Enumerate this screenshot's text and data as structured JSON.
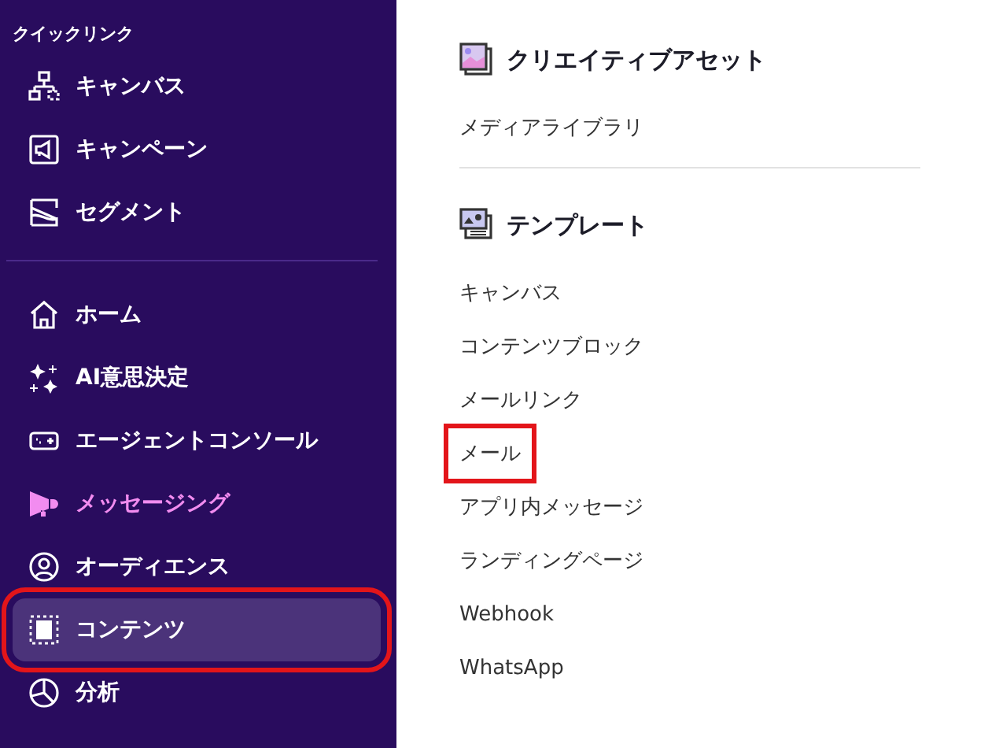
{
  "sidebar": {
    "quick_links_title": "クイックリンク",
    "quick_links": [
      {
        "label": "キャンバス",
        "kind": "canvas"
      },
      {
        "label": "キャンペーン",
        "kind": "campaign"
      },
      {
        "label": "セグメント",
        "kind": "segment"
      }
    ],
    "items": [
      {
        "label": "ホーム",
        "kind": "home",
        "selected": false,
        "active": false,
        "highlighted": false
      },
      {
        "label": "AI意思決定",
        "kind": "ai",
        "selected": false,
        "active": false,
        "highlighted": false
      },
      {
        "label": "エージェントコンソール",
        "kind": "agent",
        "selected": false,
        "active": false,
        "highlighted": false
      },
      {
        "label": "メッセージング",
        "kind": "messaging",
        "selected": false,
        "active": true,
        "highlighted": false
      },
      {
        "label": "オーディエンス",
        "kind": "audience",
        "selected": false,
        "active": false,
        "highlighted": false
      },
      {
        "label": "コンテンツ",
        "kind": "content",
        "selected": true,
        "active": false,
        "highlighted": true
      },
      {
        "label": "分析",
        "kind": "analytics",
        "selected": false,
        "active": false,
        "highlighted": false
      }
    ]
  },
  "panel": {
    "sections": [
      {
        "title": "クリエイティブアセット",
        "kind": "assets",
        "links": [
          {
            "label": "メディアライブラリ",
            "highlighted": false
          }
        ]
      },
      {
        "title": "テンプレート",
        "kind": "templates",
        "links": [
          {
            "label": "キャンバス",
            "highlighted": false
          },
          {
            "label": "コンテンツブロック",
            "highlighted": false
          },
          {
            "label": "メールリンク",
            "highlighted": false
          },
          {
            "label": "メール",
            "highlighted": true
          },
          {
            "label": "アプリ内メッセージ",
            "highlighted": false
          },
          {
            "label": "ランディングページ",
            "highlighted": false
          },
          {
            "label": "Webhook",
            "highlighted": false
          },
          {
            "label": "WhatsApp",
            "highlighted": false
          }
        ]
      }
    ]
  }
}
